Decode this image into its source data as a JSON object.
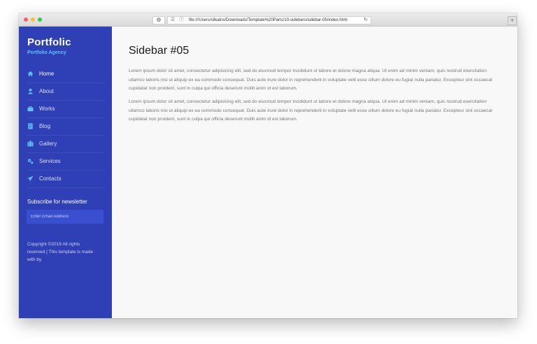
{
  "browser": {
    "url": "file:///Users/silkalns/Downloads/Template%20Parts/10-sidebars/sidebar-05/index.html",
    "new_tab_label": "+"
  },
  "sidebar": {
    "brand": "Portfolic",
    "tagline": "Portfolio Agency",
    "toggle_icon": "≡",
    "items": [
      {
        "label": "Home",
        "icon": "home-icon",
        "active": true
      },
      {
        "label": "About",
        "icon": "user-icon",
        "active": false
      },
      {
        "label": "Works",
        "icon": "briefcase-icon",
        "active": false
      },
      {
        "label": "Blog",
        "icon": "file-icon",
        "active": false
      },
      {
        "label": "Gallery",
        "icon": "suitcase-icon",
        "active": false
      },
      {
        "label": "Services",
        "icon": "cogs-icon",
        "active": false
      },
      {
        "label": "Contacts",
        "icon": "paper-plane-icon",
        "active": false
      }
    ],
    "subscribe_title": "Subscribe for newsletter",
    "email_placeholder": "Enter Email Address",
    "copyright": "Copyright ©2019 All rights reserved | This template is made with by"
  },
  "main": {
    "title": "Sidebar #05",
    "paragraphs": [
      "Lorem ipsum dolor sit amet, consectetur adipisicing elit, sed do eiusmod tempor incididunt ut labore et dolore magna aliqua. Ut enim ad minim veniam, quis nostrud exercitation ullamco laboris nisi ut aliquip ex ea commodo consequat. Duis aute irure dolor in reprehenderit in voluptate velit esse cillum dolore eu fugiat nulla pariatur. Excepteur sint occaecat cupidatat non proident, sunt in culpa qui officia deserunt mollit anim id est laborum.",
      "Lorem ipsum dolor sit amet, consectetur adipisicing elit, sed do eiusmod tempor incididunt ut labore et dolore magna aliqua. Ut enim ad minim veniam, quis nostrud exercitation ullamco laboris nisi ut aliquip ex ea commodo consequat. Duis aute irure dolor in reprehenderit in voluptate velit esse cillum dolore eu fugiat nulla pariatur. Excepteur sint occaecat cupidatat non proident, sunt in culpa qui officia deserunt mollit anim id est laborum."
    ]
  },
  "colors": {
    "sidebar_bg": "#2f3fb6",
    "accent": "#5fc2ff",
    "input_bg": "#3a4fcf",
    "page_bg": "#f8f8f8"
  }
}
